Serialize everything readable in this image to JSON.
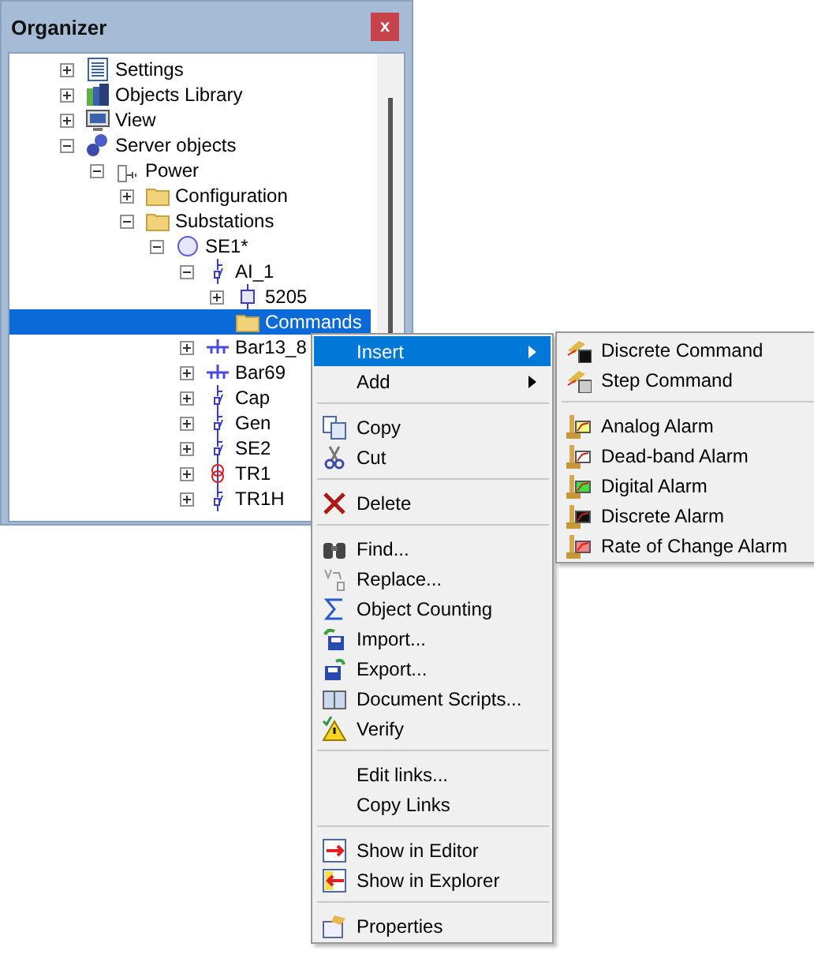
{
  "window": {
    "title": "Organizer",
    "close_label": "x"
  },
  "tree": [
    {
      "label": "Settings",
      "expanded": false
    },
    {
      "label": "Objects Library",
      "expanded": false
    },
    {
      "label": "View",
      "expanded": false
    },
    {
      "label": "Server objects",
      "expanded": true,
      "children": [
        {
          "label": "Power",
          "expanded": true,
          "children": [
            {
              "label": "Configuration",
              "expanded": false
            },
            {
              "label": "Substations",
              "expanded": true,
              "children": [
                {
                  "label": "SE1*",
                  "expanded": true,
                  "children": [
                    {
                      "label": "AI_1",
                      "expanded": true,
                      "children": [
                        {
                          "label": "5205",
                          "expanded": false
                        },
                        {
                          "label": "Commands",
                          "selected": true
                        }
                      ]
                    },
                    {
                      "label": "Bar13_8",
                      "expanded": false
                    },
                    {
                      "label": "Bar69",
                      "expanded": false
                    },
                    {
                      "label": "Cap",
                      "expanded": false
                    },
                    {
                      "label": "Gen",
                      "expanded": false
                    },
                    {
                      "label": "SE2",
                      "expanded": false
                    },
                    {
                      "label": "TR1",
                      "expanded": false
                    },
                    {
                      "label": "TR1H",
                      "expanded": false
                    }
                  ]
                }
              ]
            }
          ]
        }
      ]
    }
  ],
  "context_menu": [
    {
      "kind": "item",
      "label": "Insert",
      "submenu": true,
      "selected": true
    },
    {
      "kind": "item",
      "label": "Add",
      "submenu": true,
      "selected": false
    },
    {
      "kind": "separator"
    },
    {
      "kind": "item",
      "label": "Copy",
      "submenu": false,
      "selected": false
    },
    {
      "kind": "item",
      "label": "Cut",
      "submenu": false,
      "selected": false
    },
    {
      "kind": "separator"
    },
    {
      "kind": "item",
      "label": "Delete",
      "submenu": false,
      "selected": false
    },
    {
      "kind": "separator"
    },
    {
      "kind": "item",
      "label": "Find...",
      "submenu": false,
      "selected": false
    },
    {
      "kind": "item",
      "label": "Replace...",
      "submenu": false,
      "selected": false
    },
    {
      "kind": "item",
      "label": "Object Counting",
      "submenu": false,
      "selected": false
    },
    {
      "kind": "item",
      "label": "Import...",
      "submenu": false,
      "selected": false
    },
    {
      "kind": "item",
      "label": "Export...",
      "submenu": false,
      "selected": false
    },
    {
      "kind": "item",
      "label": "Document Scripts...",
      "submenu": false,
      "selected": false
    },
    {
      "kind": "item",
      "label": "Verify",
      "submenu": false,
      "selected": false
    },
    {
      "kind": "separator"
    },
    {
      "kind": "item",
      "label": "Edit links...",
      "submenu": false,
      "selected": false
    },
    {
      "kind": "item",
      "label": "Copy Links",
      "submenu": false,
      "selected": false
    },
    {
      "kind": "separator"
    },
    {
      "kind": "item",
      "label": "Show in Editor",
      "submenu": false,
      "selected": false
    },
    {
      "kind": "item",
      "label": "Show in Explorer",
      "submenu": false,
      "selected": false
    },
    {
      "kind": "separator"
    },
    {
      "kind": "item",
      "label": "Properties",
      "submenu": false,
      "selected": false
    }
  ],
  "submenu": [
    {
      "kind": "item",
      "label": "Discrete Command"
    },
    {
      "kind": "item",
      "label": "Step Command"
    },
    {
      "kind": "separator"
    },
    {
      "kind": "item",
      "label": "Analog Alarm"
    },
    {
      "kind": "item",
      "label": "Dead-band Alarm"
    },
    {
      "kind": "item",
      "label": "Digital Alarm"
    },
    {
      "kind": "item",
      "label": "Discrete Alarm"
    },
    {
      "kind": "item",
      "label": "Rate of Change Alarm"
    }
  ]
}
